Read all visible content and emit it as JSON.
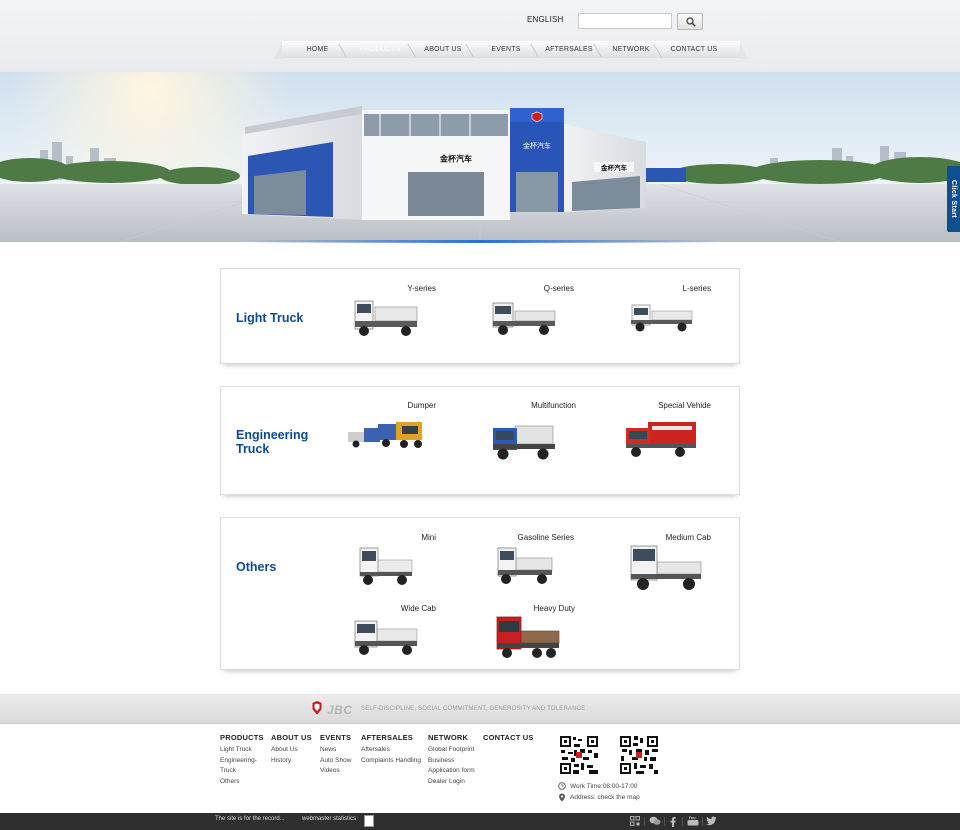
{
  "header": {
    "language": "ENGLISH",
    "search": {
      "value": "",
      "placeholder": ""
    },
    "nav": [
      "HOME",
      "PRODUCTS",
      "ABOUT US",
      "EVENTS",
      "AFTERSALES",
      "NETWORK",
      "CONTACT US"
    ],
    "active_nav": "PRODUCTS"
  },
  "banner": {
    "sign_left": "金杯汽车",
    "sign_tower": "金杯汽车",
    "sign_right": "金杯汽车",
    "side_tab": "Click Start"
  },
  "sections": [
    {
      "title_lines": [
        "Light Truck"
      ],
      "items": [
        "Y-series",
        "Q-series",
        "L-series"
      ]
    },
    {
      "title_lines": [
        "Engineering",
        "Truck"
      ],
      "items": [
        "Dumper",
        "Multifunction",
        "Special Vehide"
      ]
    },
    {
      "title_lines": [
        "Others"
      ],
      "items": [
        "Mini",
        "Gasoline Series",
        "Medium Cab",
        "Wide Cab",
        "Heavy Duty"
      ]
    }
  ],
  "footer": {
    "logo": "JBC",
    "slogan": "SELF-DISCIPLINE, SOCIAL COMMITMENT, GENEROSITY AND TOLERANCE",
    "columns": [
      {
        "head": "PRODUCTS",
        "links": [
          "Light Truck",
          "Engineering-",
          "Truck",
          "Others"
        ]
      },
      {
        "head": "ABOUT US",
        "links": [
          "About Us",
          "History"
        ]
      },
      {
        "head": "EVENTS",
        "links": [
          "News",
          "Auto Show",
          "Videos"
        ]
      },
      {
        "head": "AFTERSALES",
        "links": [
          "Aftersales",
          "Complaints Handling"
        ]
      },
      {
        "head": "NETWORK",
        "links": [
          "Global Footprint",
          "Business",
          "Application form",
          "Dealer Login"
        ]
      },
      {
        "head": "CONTACT US",
        "links": []
      }
    ],
    "work_time": "Work Time:08:00-17:00",
    "address": "Address: check the map",
    "record": "The site is for the record...",
    "stats": "webmaster statistics",
    "colors": {
      "brand_blue": "#0d4a96",
      "nav_active": "#1d6fc8",
      "truck_red": "#c8201e"
    }
  }
}
